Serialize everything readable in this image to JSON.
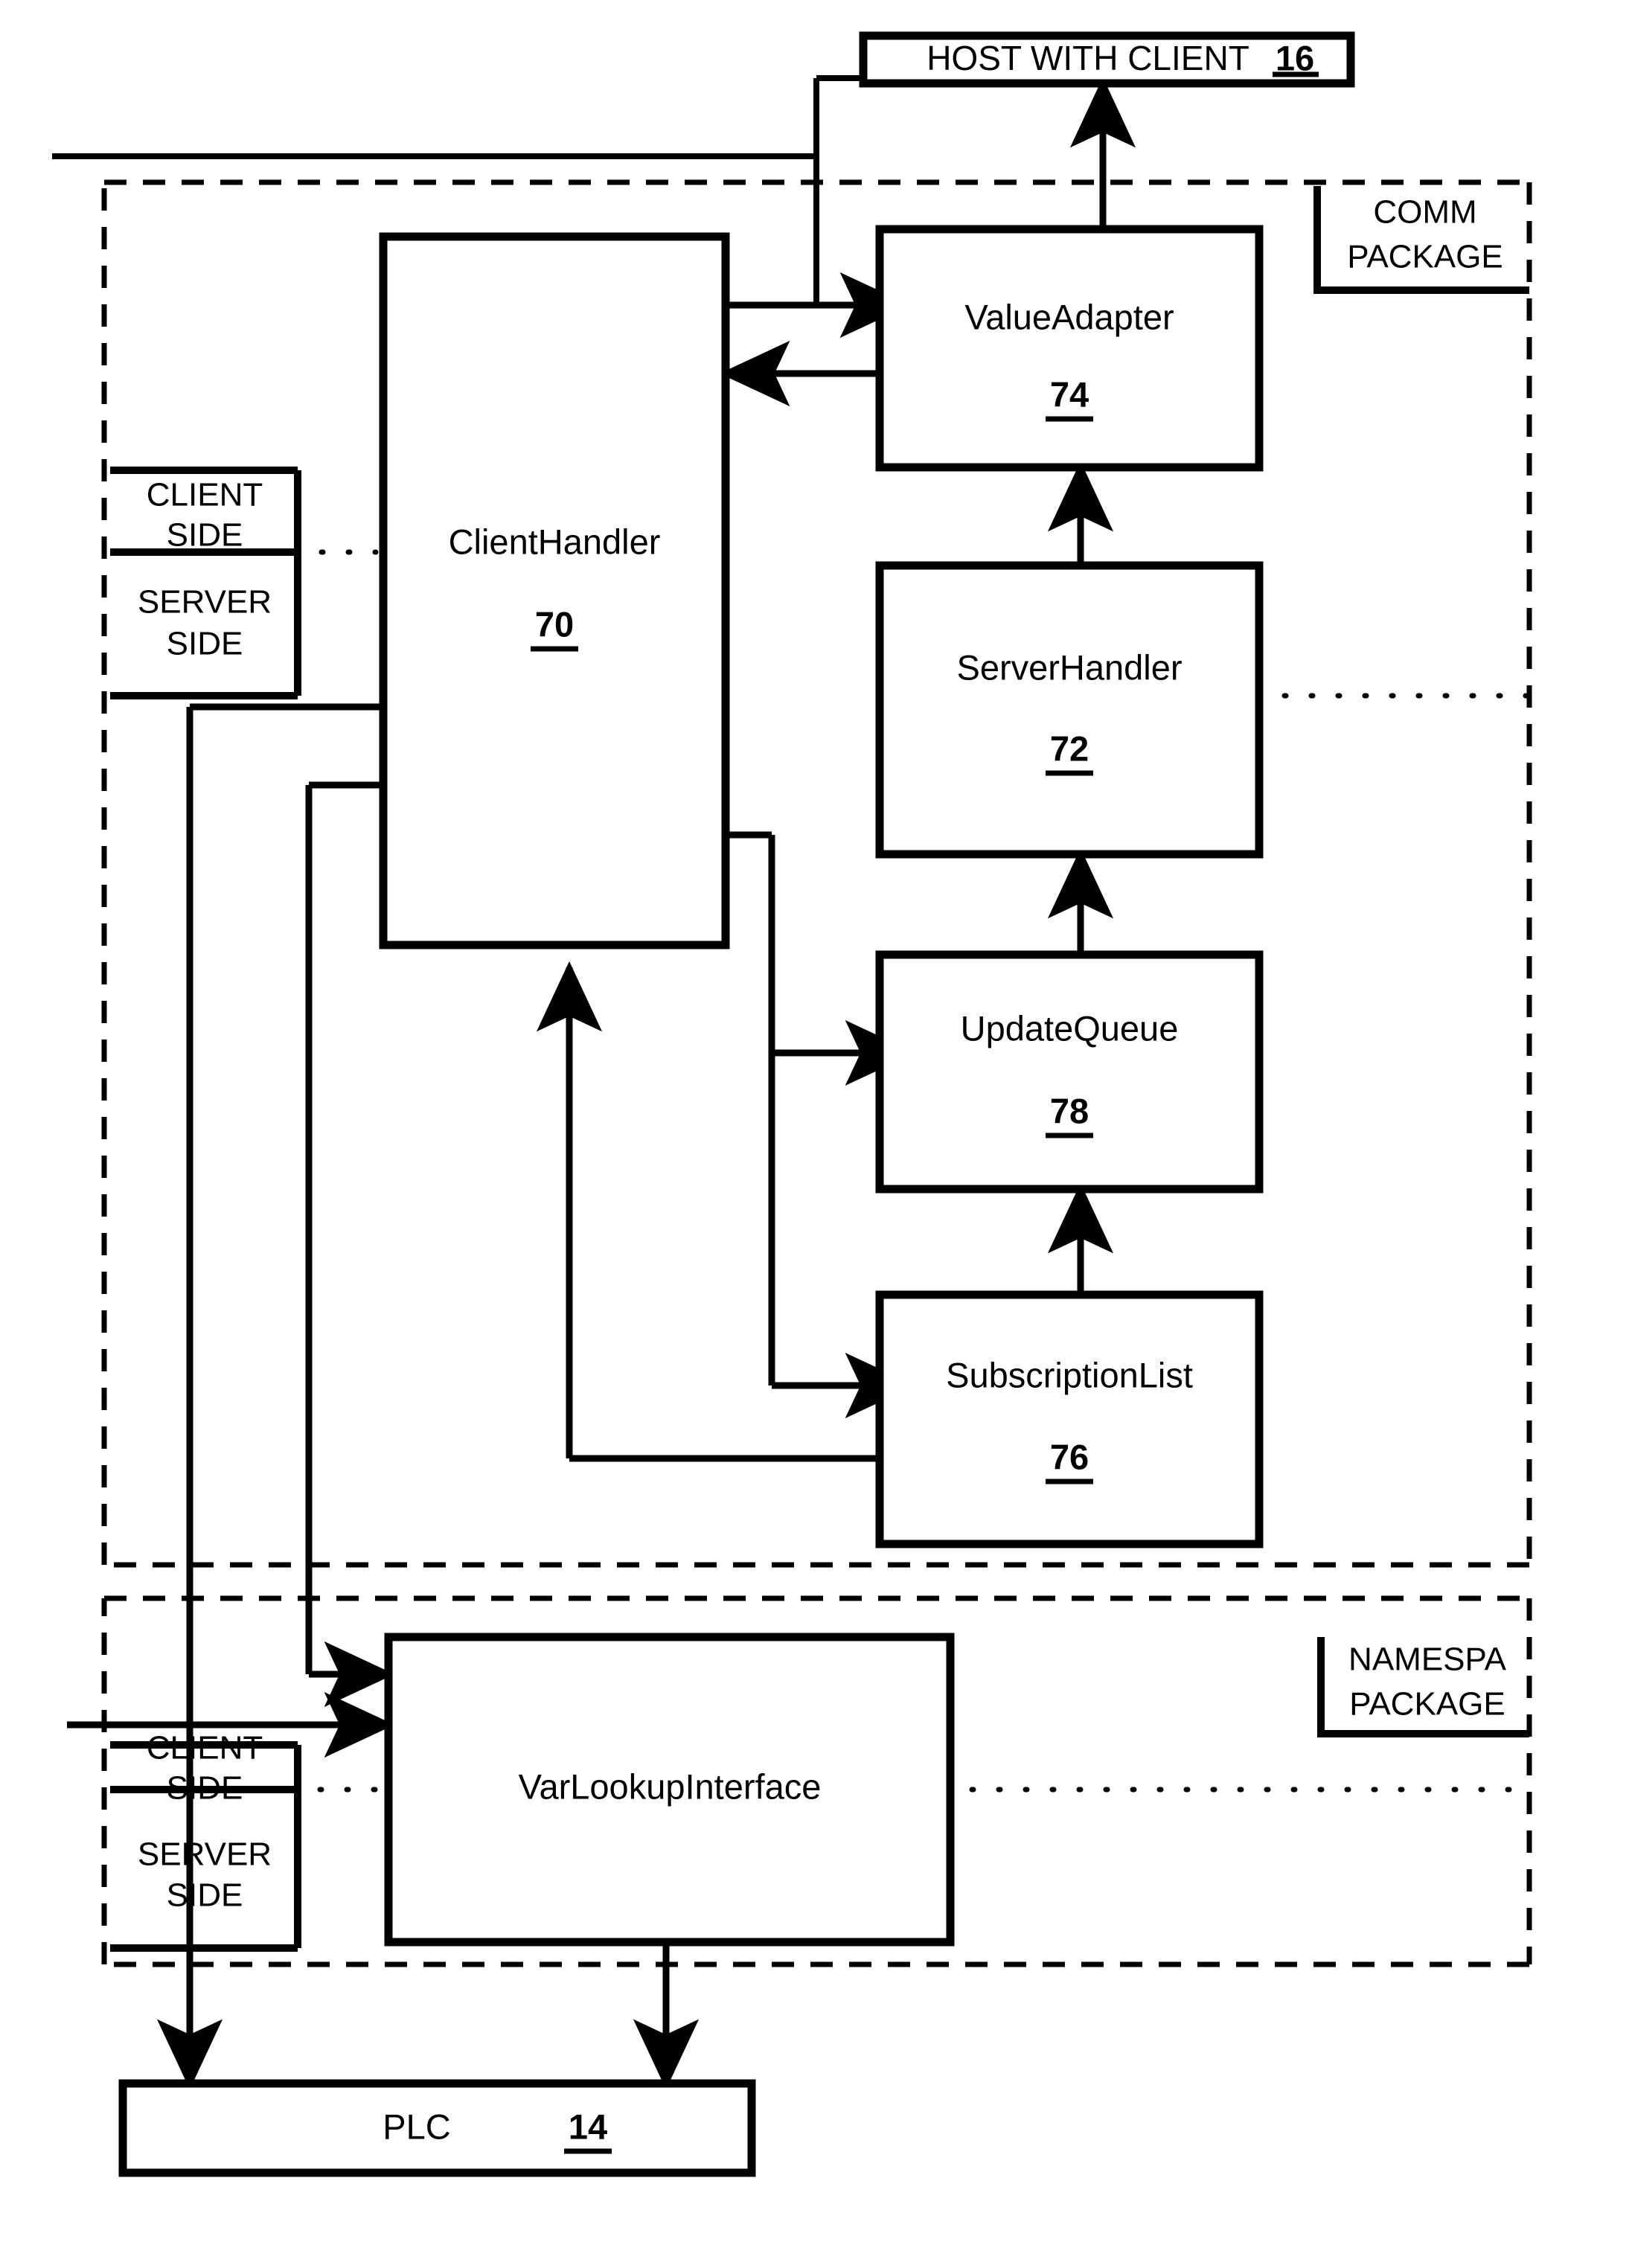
{
  "diagram": {
    "title_text": "",
    "nodes": {
      "host": {
        "label": "HOST WITH CLIENT",
        "ref": "16"
      },
      "client_handler": {
        "label": "ClientHandler",
        "ref": "70"
      },
      "value_adapter": {
        "label": "ValueAdapter",
        "ref": "74"
      },
      "server_handler": {
        "label": "ServerHandler",
        "ref": "72"
      },
      "update_queue": {
        "label": "UpdateQueue",
        "ref": "78"
      },
      "subscription_list": {
        "label": "SubscriptionList",
        "ref": "76"
      },
      "var_lookup": {
        "label": "VarLookupInterface",
        "ref": ""
      },
      "plc": {
        "label": "PLC",
        "ref": "14"
      }
    },
    "packages": {
      "comm": {
        "line1": "COMM",
        "line2": "PACKAGE"
      },
      "namespace": {
        "line1": "NAMESPA",
        "line2": "PACKAGE"
      }
    },
    "side_labels_upper": {
      "client": "CLIENT SIDE",
      "client_l1": "CLIENT",
      "client_l2": "SIDE",
      "server_l1": "SERVER",
      "server_l2": "SIDE"
    },
    "side_labels_lower": {
      "client_l1": "CLIENT",
      "client_l2": "SIDE",
      "server_l1": "SERVER",
      "server_l2": "SIDE"
    },
    "colors": {
      "ink": "#000000",
      "paper": "#ffffff"
    }
  }
}
